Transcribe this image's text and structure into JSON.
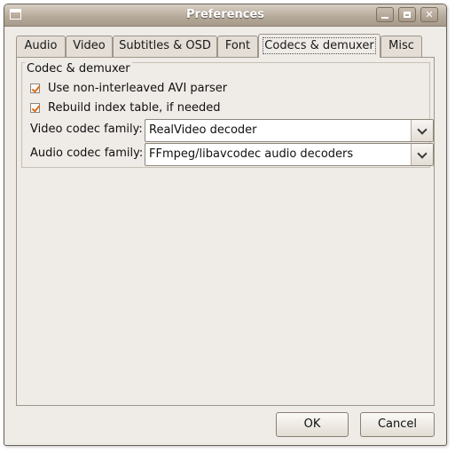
{
  "window": {
    "title": "Preferences"
  },
  "titlebar_buttons": {
    "minimize": "minimize-icon",
    "maximize": "maximize-icon",
    "close": "close-icon",
    "close_glyph": "✕"
  },
  "tabs": [
    {
      "label": "Audio",
      "active": false
    },
    {
      "label": "Video",
      "active": false
    },
    {
      "label": "Subtitles & OSD",
      "active": false
    },
    {
      "label": "Font",
      "active": false
    },
    {
      "label": "Codecs & demuxer",
      "active": true
    },
    {
      "label": "Misc",
      "active": false
    }
  ],
  "group": {
    "title": "Codec & demuxer",
    "checkboxes": [
      {
        "label": "Use non-interleaved AVI parser",
        "checked": true
      },
      {
        "label": "Rebuild index table, if needed",
        "checked": true
      }
    ],
    "video_codec": {
      "label": "Video codec family:",
      "value": "RealVideo decoder"
    },
    "audio_codec": {
      "label": "Audio codec family:",
      "value": "FFmpeg/libavcodec audio decoders"
    }
  },
  "buttons": {
    "ok": "OK",
    "cancel": "Cancel"
  },
  "colors": {
    "check_mark": "#d6701f",
    "window_bg": "#efebe7"
  }
}
